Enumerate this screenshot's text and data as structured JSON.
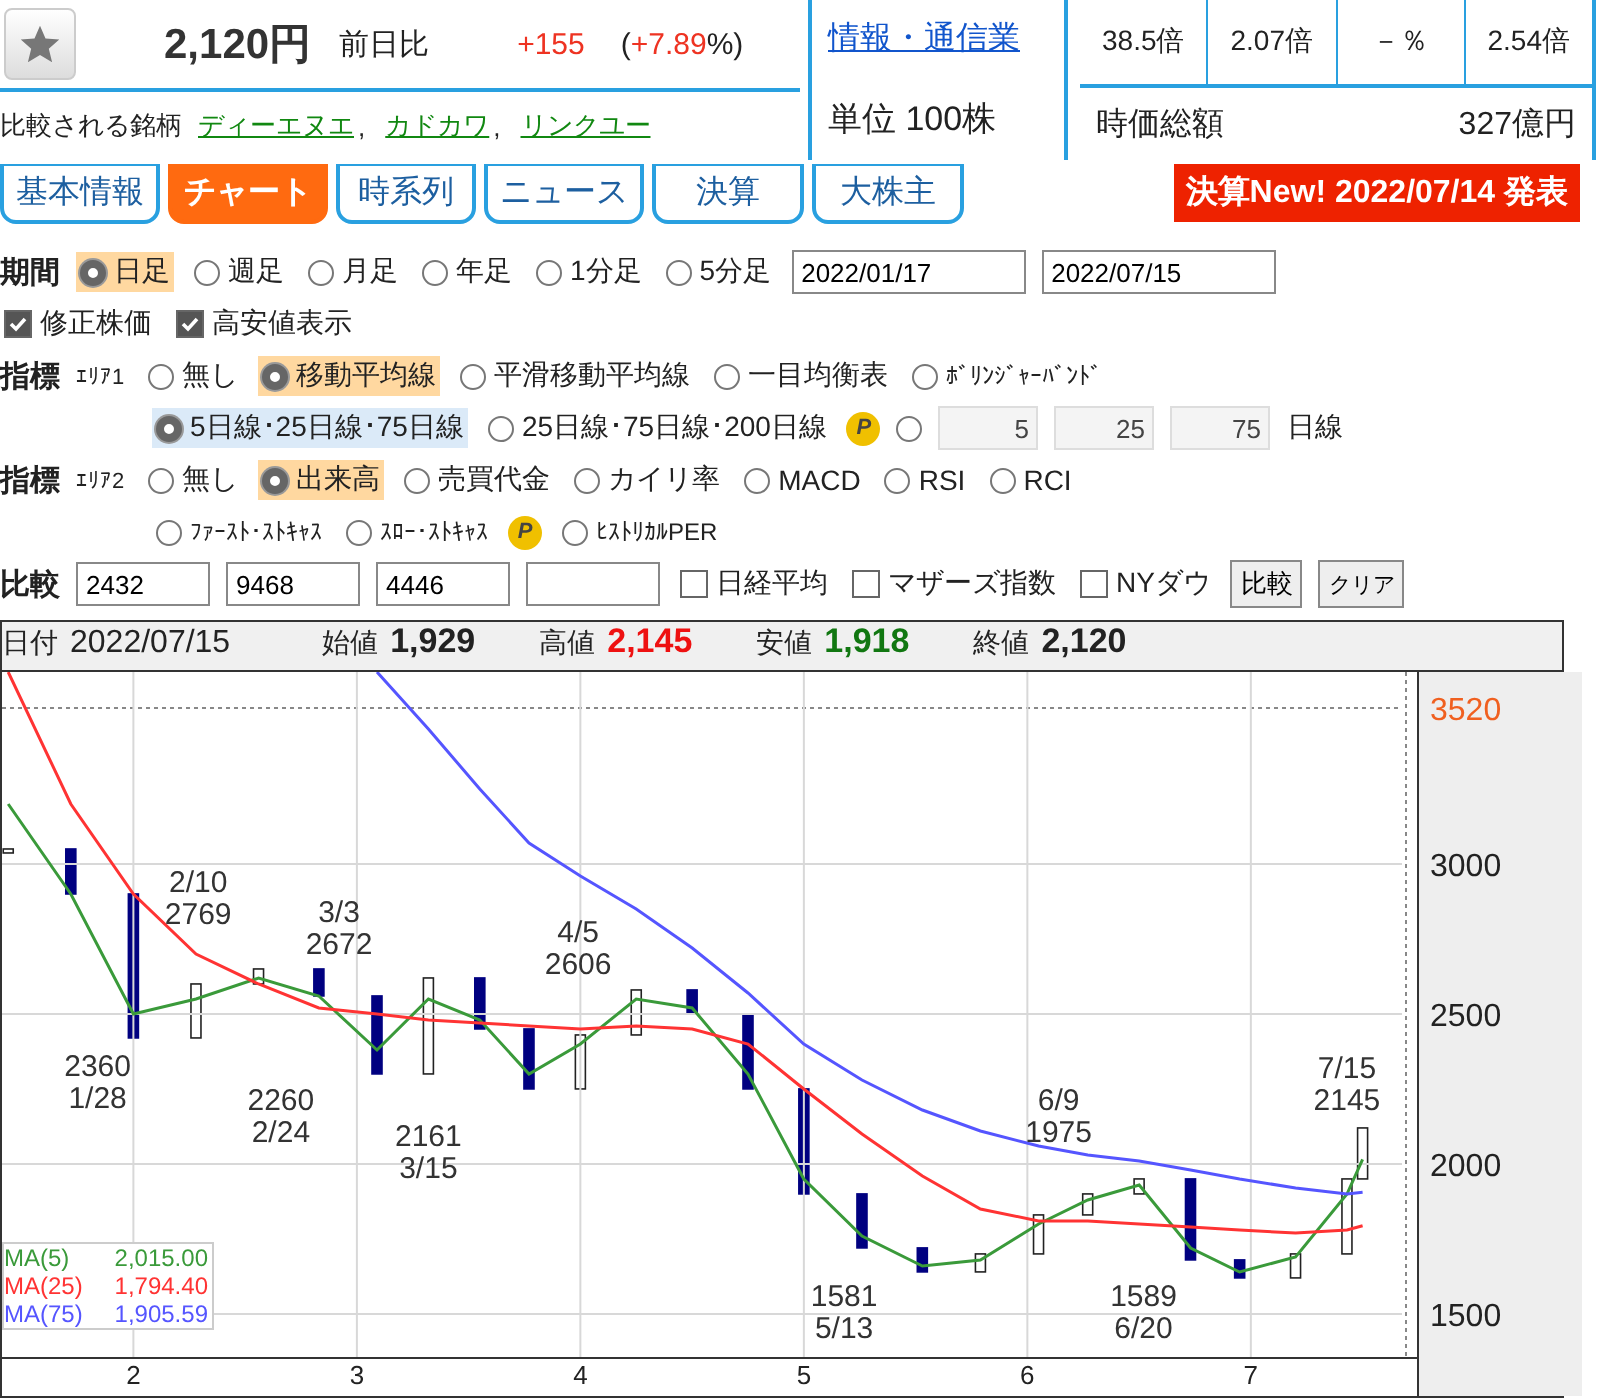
{
  "header": {
    "price": "2,120円",
    "change_label": "前日比",
    "change": "+155",
    "pct_prefix": "(",
    "pct": "+7.89",
    "pct_suffix": "%)",
    "compared_label": "比較される銘柄",
    "compared": [
      "ディーエヌエ",
      "カドカワ",
      "リンクユー"
    ],
    "separator": ",",
    "industry": "情報・通信業",
    "unit": "単位 100株",
    "ratios": [
      "38.5倍",
      "2.07倍",
      "－％",
      "2.54倍"
    ],
    "market_cap_label": "時価総額",
    "market_cap": "327億円"
  },
  "tabs": [
    {
      "label": "基本情報",
      "selected": false
    },
    {
      "label": "チャート",
      "selected": true
    },
    {
      "label": "時系列",
      "selected": false
    },
    {
      "label": "ニュース",
      "selected": false
    },
    {
      "label": "決算",
      "selected": false
    },
    {
      "label": "大株主",
      "selected": false
    }
  ],
  "notice": "決算New! 2022/07/14 発表",
  "period": {
    "label": "期間",
    "options": [
      {
        "label": "日足",
        "selected": true
      },
      {
        "label": "週足",
        "selected": false
      },
      {
        "label": "月足",
        "selected": false
      },
      {
        "label": "年足",
        "selected": false
      },
      {
        "label": "1分足",
        "selected": false
      },
      {
        "label": "5分足",
        "selected": false
      }
    ],
    "from": "2022/01/17",
    "to": "2022/07/15"
  },
  "checks": [
    {
      "label": "修正株価",
      "checked": true
    },
    {
      "label": "高安値表示",
      "checked": true
    }
  ],
  "area1": {
    "label": "指標",
    "sub": "ｴﾘｱ1",
    "options": [
      {
        "label": "無し",
        "selected": false
      },
      {
        "label": "移動平均線",
        "selected": true
      },
      {
        "label": "平滑移動平均線",
        "selected": false
      },
      {
        "label": "一目均衡表",
        "selected": false
      },
      {
        "label": "ﾎﾞﾘﾝｼﾞｬｰﾊﾞﾝﾄﾞ",
        "selected": false
      }
    ],
    "lines": [
      {
        "label": "5日線･25日線･75日線",
        "selected": true
      },
      {
        "label": "25日線･75日線･200日線",
        "selected": false
      }
    ],
    "premium": "P",
    "custom_selected": false,
    "custom": [
      "5",
      "25",
      "75"
    ],
    "custom_unit": "日線"
  },
  "area2": {
    "label": "指標",
    "sub": "ｴﾘｱ2",
    "options": [
      {
        "label": "無し",
        "selected": false
      },
      {
        "label": "出来高",
        "selected": true
      },
      {
        "label": "売買代金",
        "selected": false
      },
      {
        "label": "カイリ率",
        "selected": false
      },
      {
        "label": "MACD",
        "selected": false
      },
      {
        "label": "RSI",
        "selected": false
      },
      {
        "label": "RCI",
        "selected": false
      }
    ],
    "options2": [
      {
        "label": "ﾌｧｰｽﾄ･ｽﾄｷｬｽ",
        "selected": false
      },
      {
        "label": "ｽﾛｰ･ｽﾄｷｬｽ",
        "selected": false
      },
      {
        "label": "ﾋｽﾄﾘｶﾙPER",
        "selected": false
      }
    ],
    "premium": "P"
  },
  "compare": {
    "label": "比較",
    "codes": [
      "2432",
      "9468",
      "4446"
    ],
    "indices": [
      {
        "label": "日経平均",
        "checked": false
      },
      {
        "label": "マザーズ指数",
        "checked": false
      },
      {
        "label": "NYダウ",
        "checked": false
      }
    ],
    "buttons": [
      "比較",
      "クリア"
    ]
  },
  "quote": {
    "date_label": "日付",
    "date": "2022/07/15",
    "items": [
      {
        "label": "始値",
        "value": "1,929",
        "color": "#222222"
      },
      {
        "label": "高値",
        "value": "2,145",
        "color": "#ee1111"
      },
      {
        "label": "安値",
        "value": "1,918",
        "color": "#117711"
      },
      {
        "label": "終値",
        "value": "2,120",
        "color": "#222222"
      }
    ]
  },
  "chart": {
    "chart_data": {
      "type": "line",
      "x": [
        1.44,
        1.72,
        2.0,
        2.28,
        2.56,
        2.83,
        3.09,
        3.32,
        3.55,
        3.77,
        4.0,
        4.25,
        4.5,
        4.75,
        5.0,
        5.26,
        5.53,
        5.79,
        6.05,
        6.27,
        6.5,
        6.73,
        6.95,
        7.2,
        7.43,
        7.5
      ],
      "series": [
        {
          "name": "MA(5)",
          "color": "#3a9a3a",
          "values": [
            3200,
            2900,
            2500,
            2550,
            2620,
            2560,
            2380,
            2550,
            2480,
            2300,
            2400,
            2550,
            2520,
            2300,
            1950,
            1760,
            1660,
            1680,
            1800,
            1880,
            1930,
            1720,
            1640,
            1690,
            1900,
            2015
          ]
        },
        {
          "name": "MA(25)",
          "color": "#ff3333",
          "values": [
            3640,
            3200,
            2900,
            2700,
            2600,
            2520,
            2500,
            2480,
            2470,
            2460,
            2450,
            2460,
            2450,
            2400,
            2250,
            2100,
            1960,
            1850,
            1810,
            1810,
            1800,
            1790,
            1780,
            1770,
            1780,
            1794
          ]
        },
        {
          "name": "MA(75)",
          "color": "#5555ff",
          "values": [
            null,
            null,
            null,
            null,
            null,
            null,
            3640,
            3450,
            3250,
            3070,
            2960,
            2850,
            2720,
            2570,
            2400,
            2280,
            2180,
            2110,
            2060,
            2030,
            2010,
            1980,
            1950,
            1920,
            1900,
            1906
          ]
        }
      ],
      "xlim": [
        1.43,
        7.73
      ],
      "ylim": [
        1353,
        3640
      ],
      "xticks": [
        2,
        3,
        4,
        5,
        6,
        7
      ],
      "yticks": [
        1500,
        2000,
        2500,
        3000,
        3520
      ],
      "grid": true,
      "annotations": [
        "2/10\n2769",
        "3/3\n2672",
        "4/5\n2606",
        "2360\n1/28",
        "2260\n2/24",
        "2161\n3/15",
        "1581\n5/13",
        "6/9\n1975",
        "1589\n6/20",
        "7/15\n2145"
      ]
    },
    "legend": [
      "2,015.00",
      "1,794.40",
      "1,905.59"
    ]
  }
}
